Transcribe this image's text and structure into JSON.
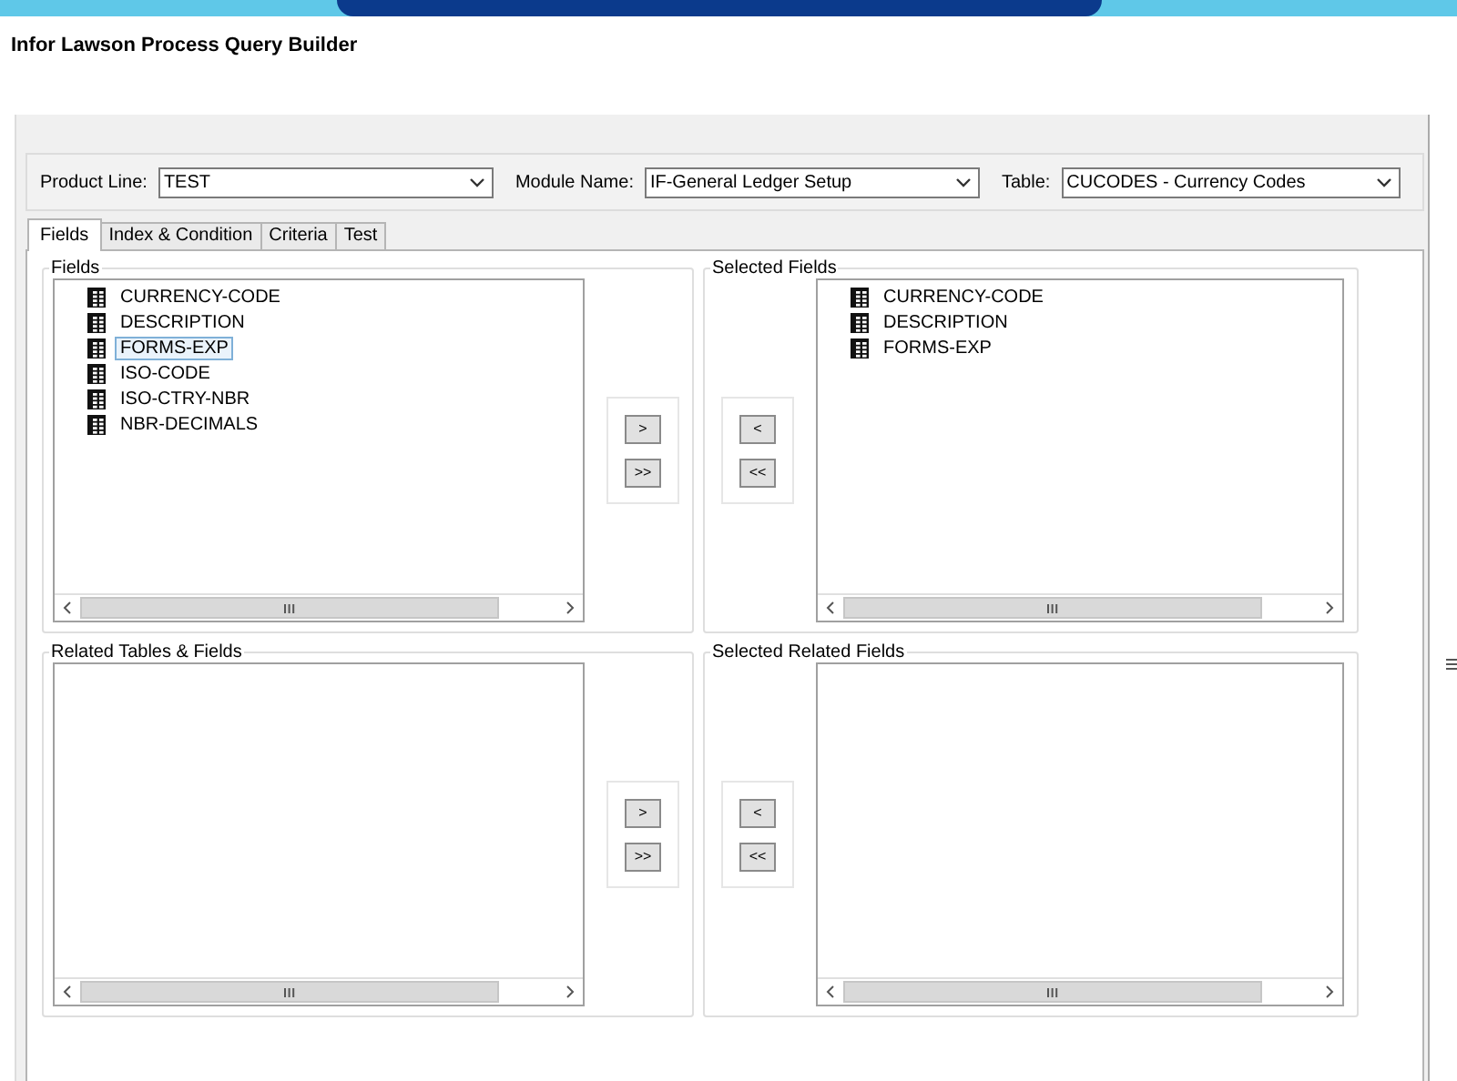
{
  "window": {
    "title": "Infor Lawson Process Query Builder"
  },
  "filters": [
    {
      "label": "Product Line:",
      "value": "TEST"
    },
    {
      "label": "Module Name:",
      "value": "IF-General Ledger Setup"
    },
    {
      "label": "Table:",
      "value": "CUCODES - Currency Codes"
    }
  ],
  "tabs": [
    {
      "label": "Fields",
      "selected": true
    },
    {
      "label": "Index & Condition",
      "selected": false
    },
    {
      "label": "Criteria",
      "selected": false
    },
    {
      "label": "Test",
      "selected": false
    }
  ],
  "groups": [
    {
      "title": "Fields",
      "kind": "source",
      "buttons": [
        ">",
        ">>"
      ],
      "items": [
        {
          "label": "CURRENCY-CODE",
          "selected": false
        },
        {
          "label": "DESCRIPTION",
          "selected": false
        },
        {
          "label": "FORMS-EXP",
          "selected": true
        },
        {
          "label": "ISO-CODE",
          "selected": false
        },
        {
          "label": "ISO-CTRY-NBR",
          "selected": false
        },
        {
          "label": "NBR-DECIMALS",
          "selected": false
        }
      ]
    },
    {
      "title": "Selected Fields",
      "kind": "target",
      "buttons": [
        "<",
        "<<"
      ],
      "items": [
        {
          "label": "CURRENCY-CODE",
          "selected": false
        },
        {
          "label": "DESCRIPTION",
          "selected": false
        },
        {
          "label": "FORMS-EXP",
          "selected": false
        }
      ]
    },
    {
      "title": "Related Tables & Fields",
      "kind": "source",
      "buttons": [
        ">",
        ">>"
      ]
    },
    {
      "title": "Selected Related Fields",
      "kind": "target",
      "buttons": [
        "<",
        "<<"
      ]
    }
  ]
}
